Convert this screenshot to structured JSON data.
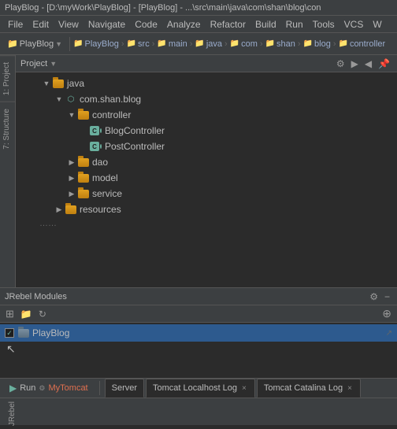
{
  "titleBar": {
    "text": "PlayBlog - [D:\\myWork\\PlayBlog] - [PlayBlog] - ...\\src\\main\\java\\com\\shan\\blog\\con"
  },
  "menuBar": {
    "items": [
      "File",
      "Edit",
      "View",
      "Navigate",
      "Code",
      "Analyze",
      "Refactor",
      "Build",
      "Run",
      "Tools",
      "VCS",
      "W"
    ]
  },
  "toolbar": {
    "projectLabel": "PlayBlog",
    "breadcrumbs": [
      "PlayBlog",
      "src",
      "main",
      "java",
      "com",
      "shan",
      "blog",
      "controller"
    ]
  },
  "projectPanel": {
    "title": "Project",
    "tree": [
      {
        "id": "java",
        "label": "java",
        "type": "folder",
        "indent": 2,
        "expanded": true
      },
      {
        "id": "com.shan.blog",
        "label": "com.shan.blog",
        "type": "package",
        "indent": 3,
        "expanded": true
      },
      {
        "id": "controller",
        "label": "controller",
        "type": "folder",
        "indent": 4,
        "expanded": true
      },
      {
        "id": "BlogController",
        "label": "BlogController",
        "type": "java-spring",
        "indent": 5,
        "selected": false
      },
      {
        "id": "PostController",
        "label": "PostController",
        "type": "java-spring",
        "indent": 5,
        "selected": false
      },
      {
        "id": "dao",
        "label": "dao",
        "type": "folder",
        "indent": 4,
        "expanded": false
      },
      {
        "id": "model",
        "label": "model",
        "type": "folder",
        "indent": 4,
        "expanded": false
      },
      {
        "id": "service",
        "label": "service",
        "type": "folder",
        "indent": 4,
        "expanded": false
      },
      {
        "id": "resources",
        "label": "resources",
        "type": "folder",
        "indent": 3,
        "expanded": false
      }
    ]
  },
  "jrebelPanel": {
    "title": "JRebel Modules",
    "modules": [
      {
        "id": "PlayBlog",
        "label": "PlayBlog",
        "checked": true
      }
    ]
  },
  "bottomBar": {
    "runLabel": "Run",
    "serverLabel": "MyTomcat",
    "tabs": [
      {
        "id": "server",
        "label": "Server",
        "active": false
      },
      {
        "id": "tomcat-localhost",
        "label": "Tomcat Localhost Log",
        "active": false
      },
      {
        "id": "tomcat-catalina",
        "label": "Tomcat Catalina Log",
        "active": false
      }
    ]
  },
  "sideTabs": {
    "left": [
      "1: Project",
      "7: Structure"
    ],
    "right": [],
    "bottomLeft": "JRebel"
  },
  "icons": {
    "gear": "⚙",
    "settings": "⚙",
    "chevronDown": "▼",
    "chevronRight": "▶",
    "check": "✓",
    "close": "×",
    "play": "▶",
    "refresh": "↻",
    "add": "+",
    "minus": "−",
    "dots": "…"
  }
}
